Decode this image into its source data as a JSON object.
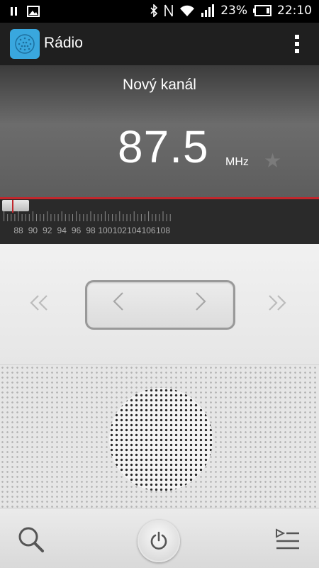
{
  "status_bar": {
    "battery": "23%",
    "time": "22:10",
    "icons": [
      "pause-icon",
      "image-icon",
      "bluetooth-icon",
      "nfc-icon",
      "wifi-icon",
      "signal-icon",
      "battery-icon"
    ]
  },
  "app_bar": {
    "title": "Rádio",
    "menu_icon": "overflow-menu-icon"
  },
  "display": {
    "station_name": "Nový kanál",
    "frequency": "87.5",
    "unit": "MHz",
    "favorite_icon": "star-icon"
  },
  "tuner": {
    "ticks": [
      "88",
      "90",
      "92",
      "94",
      "96",
      "98",
      "100",
      "102",
      "104",
      "106",
      "108"
    ],
    "current_mhz": 87.5,
    "min_mhz": 87.5,
    "max_mhz": 108,
    "accent_color": "#c0272d"
  },
  "controls": {
    "seek_back_icon": "double-chevron-left-icon",
    "seek_forward_icon": "double-chevron-right-icon",
    "step_back_icon": "chevron-left-icon",
    "step_forward_icon": "chevron-right-icon"
  },
  "bottom_bar": {
    "search_icon": "search-icon",
    "power_icon": "power-icon",
    "list_icon": "playlist-icon"
  }
}
